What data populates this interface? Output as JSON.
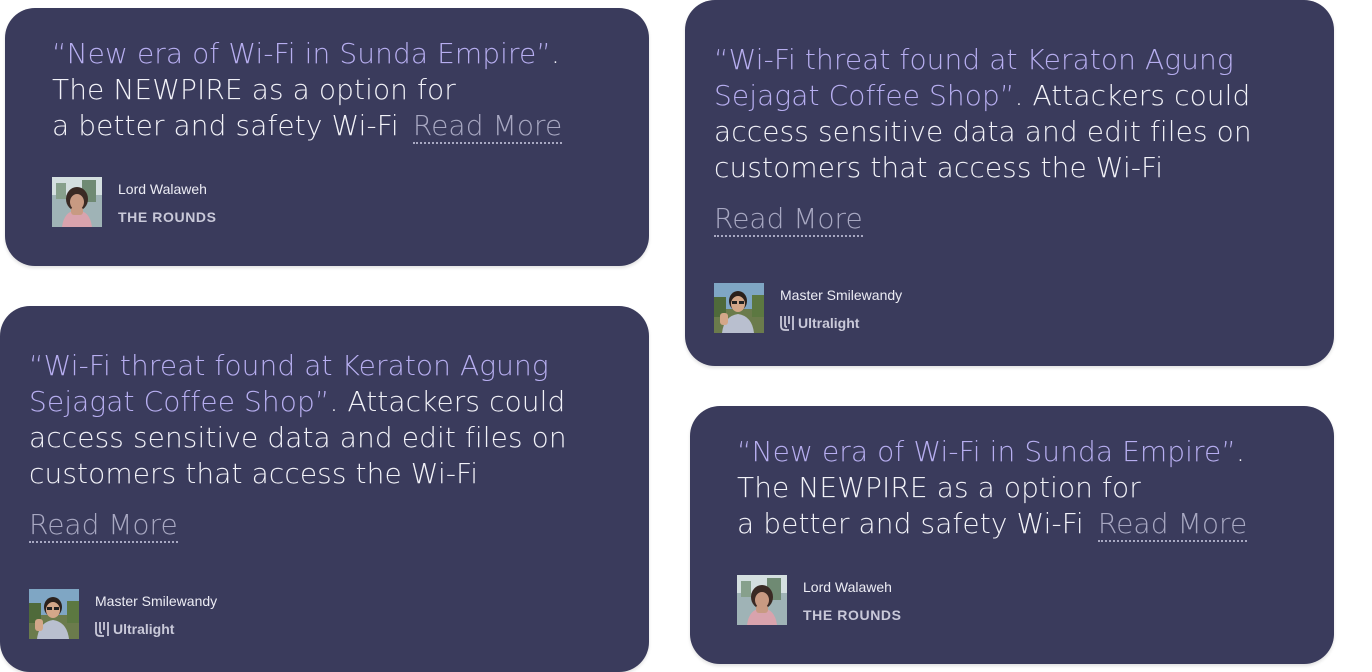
{
  "colors": {
    "card_background": "#3a3b5c",
    "quote_highlight": "#b7aef0",
    "quote_text": "#f2f2f8",
    "read_more": "#a8a8c2",
    "page_background": "#ffffff"
  },
  "cards": [
    {
      "quote_highlight": "“New era of Wi-Fi in Sunda Empire”",
      "quote_line1_rest": ".",
      "quote_line2": "The NEWPIRE as a option for",
      "quote_line3": "a better and safety Wi-Fi",
      "read_more": "Read More",
      "author_name": "Lord Walaweh",
      "company": "THE ROUNDS",
      "avatar_icon": "portrait-photo"
    },
    {
      "quote_line1": "“Wi-Fi threat found at Keraton Agung",
      "quote_line2_highlight": "Sejagat Coffee Shop”",
      "quote_line2_rest": ". Attackers could",
      "quote_line3": "access sensitive data and edit files on",
      "quote_line4": "customers that access the Wi-Fi",
      "read_more": "Read More",
      "author_name": "Master Smilewandy",
      "company": "Ultralight",
      "company_logo_icon": "ultralight-logo",
      "avatar_icon": "portrait-photo"
    },
    {
      "quote_line1": "“Wi-Fi threat found at Keraton Agung",
      "quote_line2_highlight": "Sejagat Coffee Shop”",
      "quote_line2_rest": ". Attackers could",
      "quote_line3": "access sensitive data and edit files on",
      "quote_line4": "customers that access the Wi-Fi",
      "read_more": "Read More",
      "author_name": "Master Smilewandy",
      "company": "Ultralight",
      "company_logo_icon": "ultralight-logo",
      "avatar_icon": "portrait-photo"
    },
    {
      "quote_highlight": "“New era of Wi-Fi in Sunda Empire”",
      "quote_line1_rest": ".",
      "quote_line2": "The NEWPIRE as a option for",
      "quote_line3": "a better and safety Wi-Fi",
      "read_more": "Read More",
      "author_name": "Lord Walaweh",
      "company": "THE ROUNDS",
      "avatar_icon": "portrait-photo"
    }
  ]
}
